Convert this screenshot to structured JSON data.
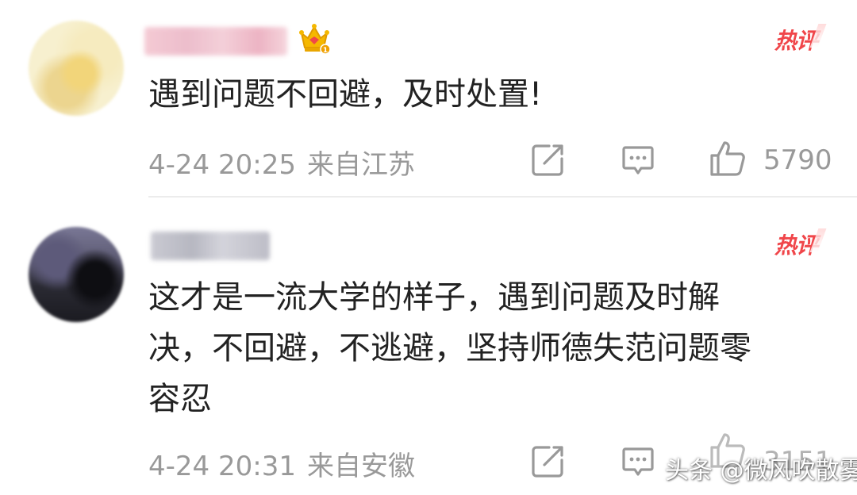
{
  "comments": [
    {
      "hot_badge": "热评",
      "text_lines": [
        "遇到问题不回避，及时处置!"
      ],
      "date": "4-24 20:25",
      "location": "来自江苏",
      "likes": "5790"
    },
    {
      "hot_badge": "热评",
      "text_lines": [
        "这才是一流大学的样子，遇到问题及时解",
        "决，不回避，不逃避，坚持师德失范问题零",
        "容忍"
      ],
      "date": "4-24 20:31",
      "location": "来自安徽",
      "likes": "3151"
    }
  ],
  "watermark": "头条 @微风吹散雾",
  "colors": {
    "hot_badge": "#f0464a",
    "meta_text": "#999999",
    "crown_gold": "#f2b400"
  }
}
